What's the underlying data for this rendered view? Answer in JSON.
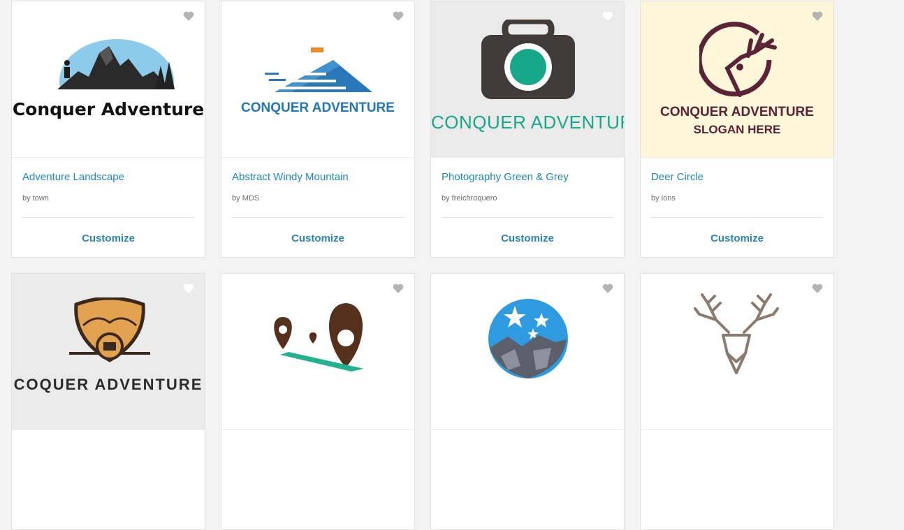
{
  "cards": [
    {
      "title": "Adventure Landscape",
      "author": "by town",
      "cta": "Customize",
      "logo_text": "Conquer Adventure",
      "thumb_bg": "#ffffff"
    },
    {
      "title": "Abstract Windy Mountain",
      "author": "by MDS",
      "cta": "Customize",
      "logo_text": "CONQUER ADVENTURE",
      "thumb_bg": "#ffffff"
    },
    {
      "title": "Photography Green & Grey",
      "author": "by freichroquero",
      "cta": "Customize",
      "logo_text": "CONQUER ADVENTURE",
      "thumb_bg": "#eaeaea"
    },
    {
      "title": "Deer Circle",
      "author": "by ions",
      "cta": "Customize",
      "logo_text": "CONQUER ADVENTURE",
      "logo_slogan": "SLOGAN HERE",
      "thumb_bg": "#fdf6d9"
    },
    {
      "logo_text": "COQUER ADVENTURE",
      "thumb_bg": "#ebebeb"
    },
    {
      "thumb_bg": "#ffffff"
    },
    {
      "thumb_bg": "#ffffff"
    },
    {
      "thumb_bg": "#ffffff"
    }
  ],
  "colors": {
    "link": "#1f86c2",
    "cta": "#2a84b5",
    "heart": "#b4b4b4"
  },
  "icons": {
    "favorite": "heart-icon"
  }
}
